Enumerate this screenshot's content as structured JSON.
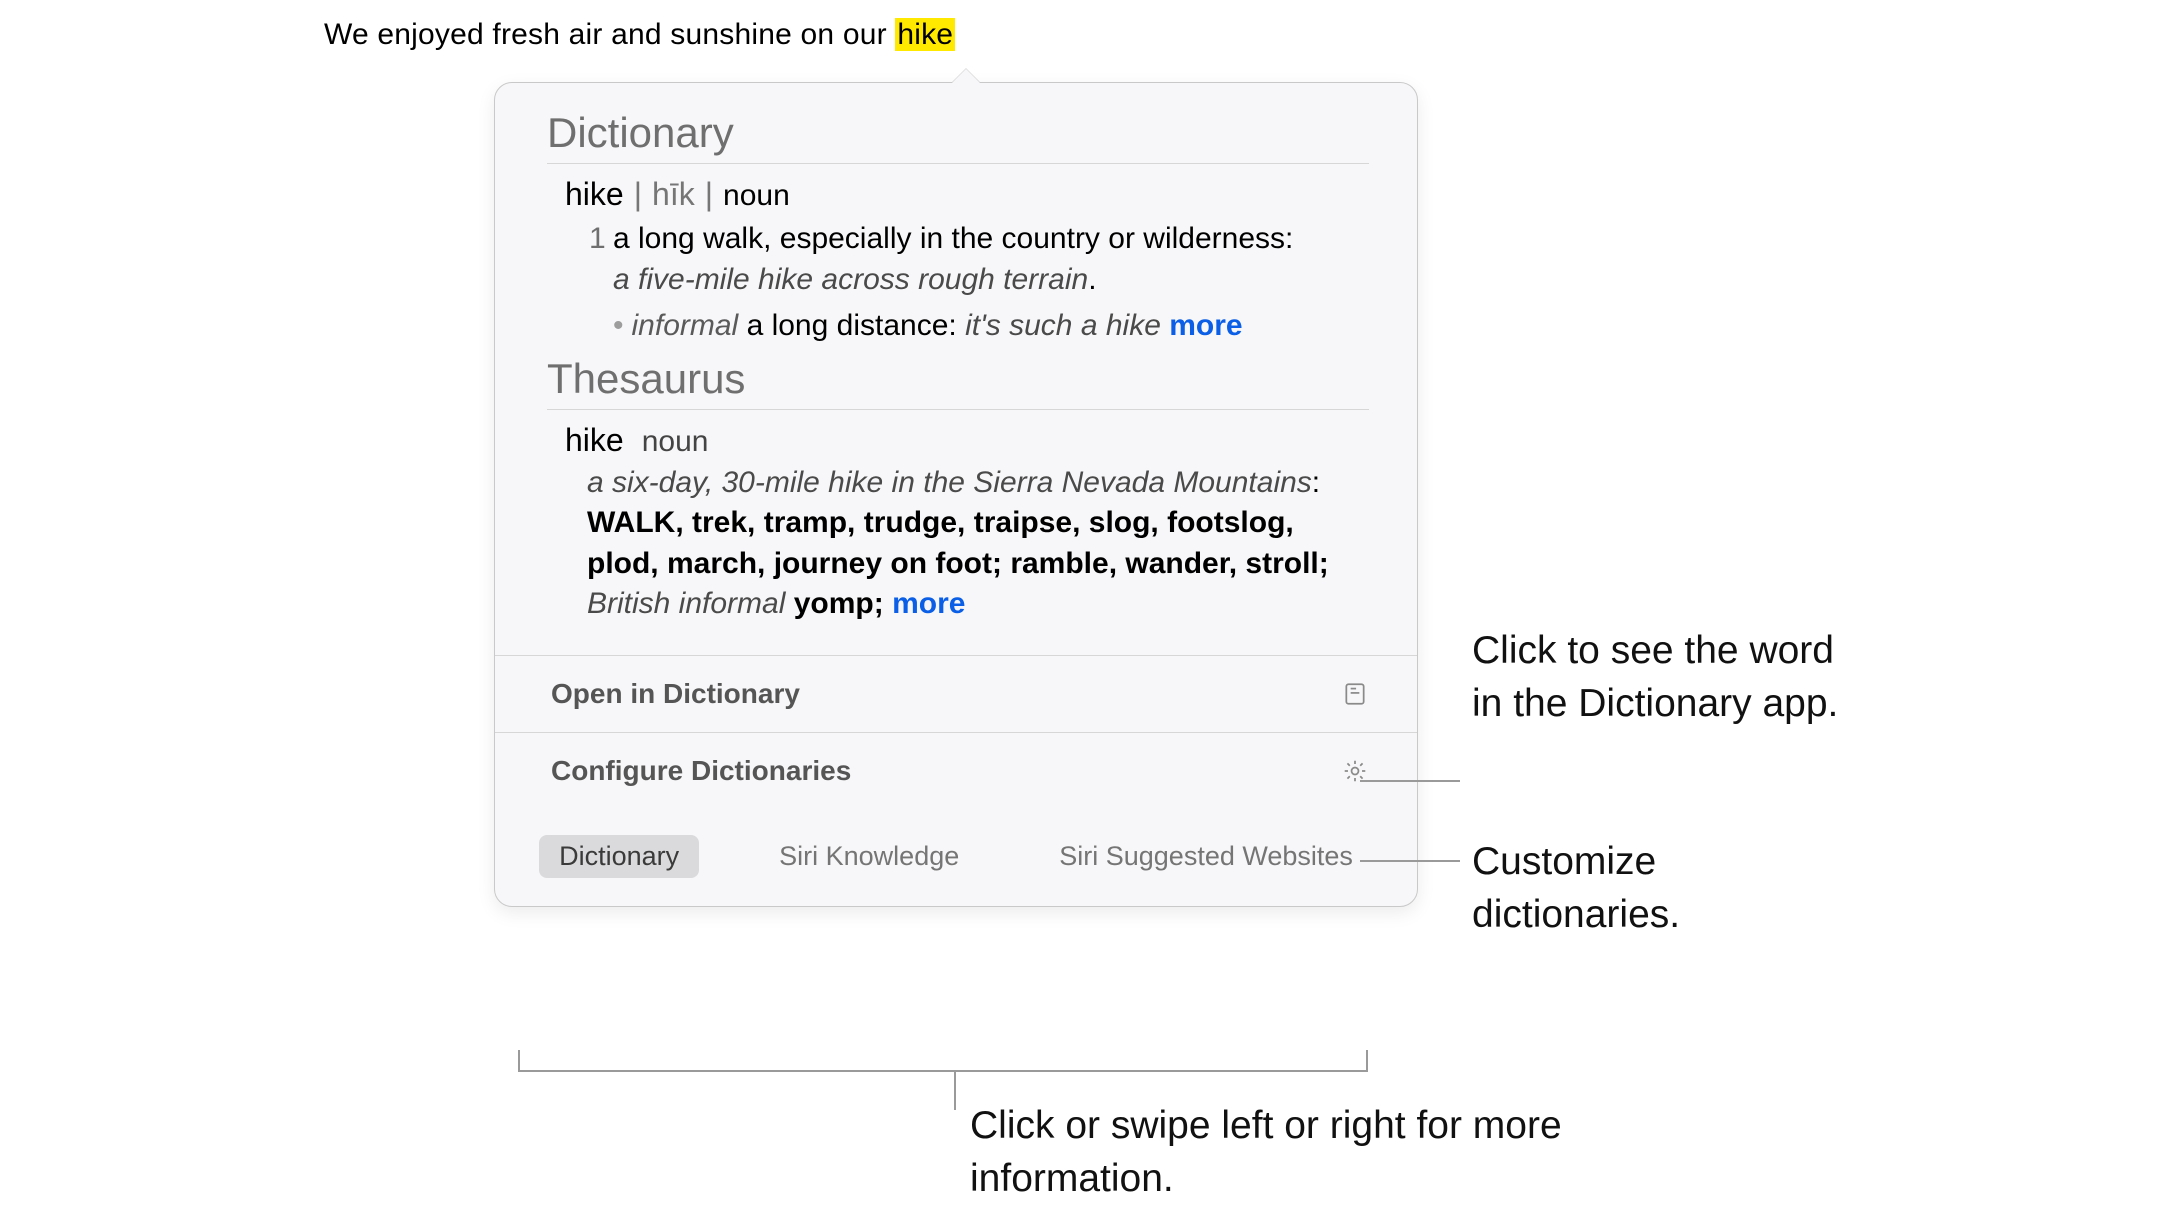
{
  "sentence": {
    "prefix": "We enjoyed fresh air and sunshine on our ",
    "highlighted": "hike"
  },
  "popover": {
    "dictionary": {
      "title": "Dictionary",
      "word": "hike",
      "pronunciation": "hīk",
      "part_of_speech": "noun",
      "sense_number": "1",
      "definition": "a long walk, especially in the country or wilderness:",
      "example": "a five-mile hike across rough terrain",
      "example_terminator": ".",
      "sub_label": "informal",
      "sub_def": "a long distance:",
      "sub_example": "it's such a hike",
      "more": "more"
    },
    "thesaurus": {
      "title": "Thesaurus",
      "word": "hike",
      "part_of_speech": "noun",
      "example": "a six-day, 30-mile hike in the Sierra Nevada Mountains",
      "colon": ":",
      "primary_synonym": "WALK",
      "synonyms_rest": ", trek, tramp, trudge, traipse, slog, footslog, plod, march, journey on foot; ramble, wander, stroll; ",
      "regional_label": "British informal",
      "regional_synonym": " yomp; ",
      "more": "more"
    },
    "actions": {
      "open": "Open in Dictionary",
      "configure": "Configure Dictionaries"
    },
    "tabs": {
      "dictionary": "Dictionary",
      "siri_knowledge": "Siri Knowledge",
      "siri_websites": "Siri Suggested Websites"
    }
  },
  "callouts": {
    "open_text": "Click to see the word in the Dictionary app.",
    "configure_text": "Customize dictionaries.",
    "tabs_text": "Click or swipe left or right for more information."
  }
}
